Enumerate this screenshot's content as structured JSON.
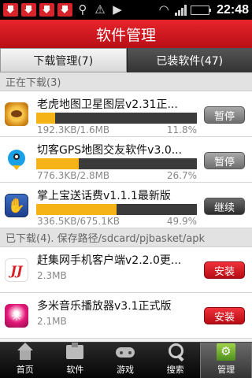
{
  "status_bar": {
    "time": "22:48",
    "notification_icons": [
      "download-icon",
      "download-icon",
      "download-icon",
      "download-icon",
      "usb-icon",
      "warning-icon",
      "play-icon"
    ],
    "battery_level": 0.85
  },
  "title": "软件管理",
  "tabs": [
    {
      "label": "下载管理(7)",
      "active": true
    },
    {
      "label": "已装软件(47)",
      "active": false
    }
  ],
  "downloading": {
    "header": "正在下载(3)",
    "items": [
      {
        "name": "老虎地图卫星图层v2.31正...",
        "size": "192.3KB/1.6MB",
        "percent": "11.8%",
        "progress": 0.118,
        "button": "暂停",
        "icon": "tiger-map-icon"
      },
      {
        "name": "切客GPS地图交友软件v3.0...",
        "size": "776.3KB/2.8MB",
        "percent": "26.7%",
        "progress": 0.267,
        "button": "暂停",
        "icon": "bird-icon"
      },
      {
        "name": "掌上宝送话费v1.1.1最新版",
        "size": "336.5KB/675.1KB",
        "percent": "49.9%",
        "progress": 0.499,
        "button": "继续",
        "icon": "hand-icon"
      }
    ]
  },
  "downloaded": {
    "header": "已下载(4). 保存路径/sdcard/pjbasket/apk",
    "items": [
      {
        "name": "赶集网手机客户端v2.2.0更...",
        "size": "2.3MB",
        "button": "安装",
        "icon": "ganji-icon"
      },
      {
        "name": "多米音乐播放器v3.1正式版",
        "size": "2.1MB",
        "button": "安装",
        "icon": "duomi-icon"
      }
    ]
  },
  "bottom_nav": [
    {
      "label": "首页",
      "icon": "home-icon",
      "active": false
    },
    {
      "label": "软件",
      "icon": "software-icon",
      "active": false
    },
    {
      "label": "游戏",
      "icon": "gamepad-icon",
      "active": false
    },
    {
      "label": "搜索",
      "icon": "search-icon",
      "active": false
    },
    {
      "label": "管理",
      "icon": "manage-icon",
      "active": true
    }
  ],
  "colors": {
    "title_red": "#d21a22",
    "progress_yellow": "#f5b318",
    "install_red": "#d4161e"
  }
}
